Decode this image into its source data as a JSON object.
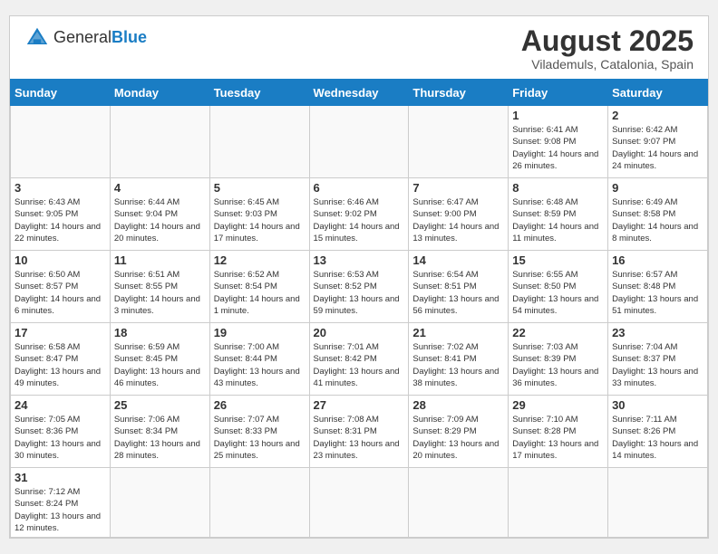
{
  "header": {
    "logo_text_normal": "General",
    "logo_text_blue": "Blue",
    "title": "August 2025",
    "location": "Vilademuls, Catalonia, Spain"
  },
  "weekdays": [
    "Sunday",
    "Monday",
    "Tuesday",
    "Wednesday",
    "Thursday",
    "Friday",
    "Saturday"
  ],
  "weeks": [
    [
      {
        "day": "",
        "info": ""
      },
      {
        "day": "",
        "info": ""
      },
      {
        "day": "",
        "info": ""
      },
      {
        "day": "",
        "info": ""
      },
      {
        "day": "",
        "info": ""
      },
      {
        "day": "1",
        "info": "Sunrise: 6:41 AM\nSunset: 9:08 PM\nDaylight: 14 hours and 26 minutes."
      },
      {
        "day": "2",
        "info": "Sunrise: 6:42 AM\nSunset: 9:07 PM\nDaylight: 14 hours and 24 minutes."
      }
    ],
    [
      {
        "day": "3",
        "info": "Sunrise: 6:43 AM\nSunset: 9:05 PM\nDaylight: 14 hours and 22 minutes."
      },
      {
        "day": "4",
        "info": "Sunrise: 6:44 AM\nSunset: 9:04 PM\nDaylight: 14 hours and 20 minutes."
      },
      {
        "day": "5",
        "info": "Sunrise: 6:45 AM\nSunset: 9:03 PM\nDaylight: 14 hours and 17 minutes."
      },
      {
        "day": "6",
        "info": "Sunrise: 6:46 AM\nSunset: 9:02 PM\nDaylight: 14 hours and 15 minutes."
      },
      {
        "day": "7",
        "info": "Sunrise: 6:47 AM\nSunset: 9:00 PM\nDaylight: 14 hours and 13 minutes."
      },
      {
        "day": "8",
        "info": "Sunrise: 6:48 AM\nSunset: 8:59 PM\nDaylight: 14 hours and 11 minutes."
      },
      {
        "day": "9",
        "info": "Sunrise: 6:49 AM\nSunset: 8:58 PM\nDaylight: 14 hours and 8 minutes."
      }
    ],
    [
      {
        "day": "10",
        "info": "Sunrise: 6:50 AM\nSunset: 8:57 PM\nDaylight: 14 hours and 6 minutes."
      },
      {
        "day": "11",
        "info": "Sunrise: 6:51 AM\nSunset: 8:55 PM\nDaylight: 14 hours and 3 minutes."
      },
      {
        "day": "12",
        "info": "Sunrise: 6:52 AM\nSunset: 8:54 PM\nDaylight: 14 hours and 1 minute."
      },
      {
        "day": "13",
        "info": "Sunrise: 6:53 AM\nSunset: 8:52 PM\nDaylight: 13 hours and 59 minutes."
      },
      {
        "day": "14",
        "info": "Sunrise: 6:54 AM\nSunset: 8:51 PM\nDaylight: 13 hours and 56 minutes."
      },
      {
        "day": "15",
        "info": "Sunrise: 6:55 AM\nSunset: 8:50 PM\nDaylight: 13 hours and 54 minutes."
      },
      {
        "day": "16",
        "info": "Sunrise: 6:57 AM\nSunset: 8:48 PM\nDaylight: 13 hours and 51 minutes."
      }
    ],
    [
      {
        "day": "17",
        "info": "Sunrise: 6:58 AM\nSunset: 8:47 PM\nDaylight: 13 hours and 49 minutes."
      },
      {
        "day": "18",
        "info": "Sunrise: 6:59 AM\nSunset: 8:45 PM\nDaylight: 13 hours and 46 minutes."
      },
      {
        "day": "19",
        "info": "Sunrise: 7:00 AM\nSunset: 8:44 PM\nDaylight: 13 hours and 43 minutes."
      },
      {
        "day": "20",
        "info": "Sunrise: 7:01 AM\nSunset: 8:42 PM\nDaylight: 13 hours and 41 minutes."
      },
      {
        "day": "21",
        "info": "Sunrise: 7:02 AM\nSunset: 8:41 PM\nDaylight: 13 hours and 38 minutes."
      },
      {
        "day": "22",
        "info": "Sunrise: 7:03 AM\nSunset: 8:39 PM\nDaylight: 13 hours and 36 minutes."
      },
      {
        "day": "23",
        "info": "Sunrise: 7:04 AM\nSunset: 8:37 PM\nDaylight: 13 hours and 33 minutes."
      }
    ],
    [
      {
        "day": "24",
        "info": "Sunrise: 7:05 AM\nSunset: 8:36 PM\nDaylight: 13 hours and 30 minutes."
      },
      {
        "day": "25",
        "info": "Sunrise: 7:06 AM\nSunset: 8:34 PM\nDaylight: 13 hours and 28 minutes."
      },
      {
        "day": "26",
        "info": "Sunrise: 7:07 AM\nSunset: 8:33 PM\nDaylight: 13 hours and 25 minutes."
      },
      {
        "day": "27",
        "info": "Sunrise: 7:08 AM\nSunset: 8:31 PM\nDaylight: 13 hours and 23 minutes."
      },
      {
        "day": "28",
        "info": "Sunrise: 7:09 AM\nSunset: 8:29 PM\nDaylight: 13 hours and 20 minutes."
      },
      {
        "day": "29",
        "info": "Sunrise: 7:10 AM\nSunset: 8:28 PM\nDaylight: 13 hours and 17 minutes."
      },
      {
        "day": "30",
        "info": "Sunrise: 7:11 AM\nSunset: 8:26 PM\nDaylight: 13 hours and 14 minutes."
      }
    ],
    [
      {
        "day": "31",
        "info": "Sunrise: 7:12 AM\nSunset: 8:24 PM\nDaylight: 13 hours and 12 minutes."
      },
      {
        "day": "",
        "info": ""
      },
      {
        "day": "",
        "info": ""
      },
      {
        "day": "",
        "info": ""
      },
      {
        "day": "",
        "info": ""
      },
      {
        "day": "",
        "info": ""
      },
      {
        "day": "",
        "info": ""
      }
    ]
  ]
}
